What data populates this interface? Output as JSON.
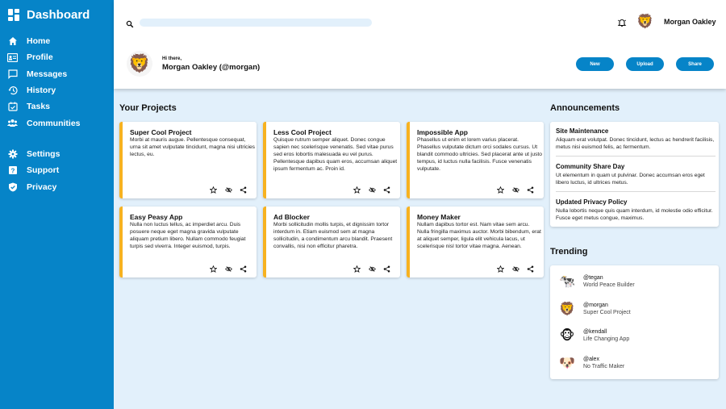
{
  "sidebar": {
    "title": "Dashboard",
    "items": [
      {
        "label": "Home",
        "icon": "home-icon"
      },
      {
        "label": "Profile",
        "icon": "profile-card-icon"
      },
      {
        "label": "Messages",
        "icon": "message-icon"
      },
      {
        "label": "History",
        "icon": "history-icon"
      },
      {
        "label": "Tasks",
        "icon": "tasks-icon"
      },
      {
        "label": "Communities",
        "icon": "communities-icon"
      }
    ],
    "items2": [
      {
        "label": "Settings",
        "icon": "gear-icon"
      },
      {
        "label": "Support",
        "icon": "help-icon"
      },
      {
        "label": "Privacy",
        "icon": "shield-icon"
      }
    ]
  },
  "header": {
    "user_name": "Morgan Oakley",
    "greeting": "Hi there,",
    "full_greeting": "Morgan Oakley (@morgan)",
    "buttons": {
      "new": "New",
      "upload": "Upload",
      "share": "Share"
    }
  },
  "projects": {
    "title": "Your Projects",
    "cards": [
      {
        "title": "Super Cool Project",
        "text": "Morbi at mauris augue. Pellentesque consequat, urna sit amet vulputate tincidunt, magna nisi ultricies lectus, eu."
      },
      {
        "title": "Less Cool Project",
        "text": "Quisque rutrum semper aliquet. Donec congue sapien nec scelerisque venenatis. Sed vitae purus sed eros lobortis malesuada eu vel purus. Pellentesque dapibus quam eros, accumsan aliquet ipsum fermentum ac. Proin id."
      },
      {
        "title": "Impossible App",
        "text": "Phasellus ut enim et lorem varius placerat. Phasellus vulputate dictum orci sodales cursus. Ut blandit commodo ultricies. Sed placerat ante ut justo tempus, id luctus nulla facilisis. Fusce venenatis vulputate."
      },
      {
        "title": "Easy Peasy App",
        "text": "Nulla non luctus tellus, ac imperdiet arcu. Duis posuere neque eget magna gravida vulputate aliquam pretium libero. Nullam commodo feugiat turpis sed viverra. Integer euismod, turpis."
      },
      {
        "title": "Ad Blocker",
        "text": "Morbi sollicitudin mollis turpis, et dignissim tortor interdum in. Etiam euismod sem at magna sollicitudin, a condimentum arcu blandit. Praesent convallis, nisi non efficitur pharetra."
      },
      {
        "title": "Money Maker",
        "text": "Nullam dapibus tortor est. Nam vitae sem arcu. Nulla fringilla maximus auctor. Morbi bibendum, erat at aliquet semper, ligula elit vehicula lacus, ut scelerisque nisl tortor vitae magna. Aenean."
      }
    ]
  },
  "announcements": {
    "title": "Announcements",
    "items": [
      {
        "title": "Site Maintenance",
        "text": "Aliquam erat volutpat. Donec tincidunt, lectus ac hendrerit facilisis, metus nisi euismod felis, ac fermentum."
      },
      {
        "title": "Community Share Day",
        "text": "Ut elementum in quam ut pulvinar. Donec accumsan eros eget libero luctus, id ultrices metus."
      },
      {
        "title": "Updated Privacy Policy",
        "text": "Nulla lobortis neque quis quam interdum, id molestie odio efficitur. Fusce eget metus congue, maximus."
      }
    ]
  },
  "trending": {
    "title": "Trending",
    "items": [
      {
        "handle": "@tegan",
        "project": "World Peace Builder",
        "avatar": "🐄"
      },
      {
        "handle": "@morgan",
        "project": "Super Cool Project",
        "avatar": "🦁"
      },
      {
        "handle": "@kendall",
        "project": "Life Changing App",
        "avatar": "🐵"
      },
      {
        "handle": "@alex",
        "project": "No Traffic Maker",
        "avatar": "🐶"
      }
    ]
  },
  "colors": {
    "sidebar": "#0684c8",
    "accent": "#f7b220",
    "background": "#e2f0fb"
  }
}
